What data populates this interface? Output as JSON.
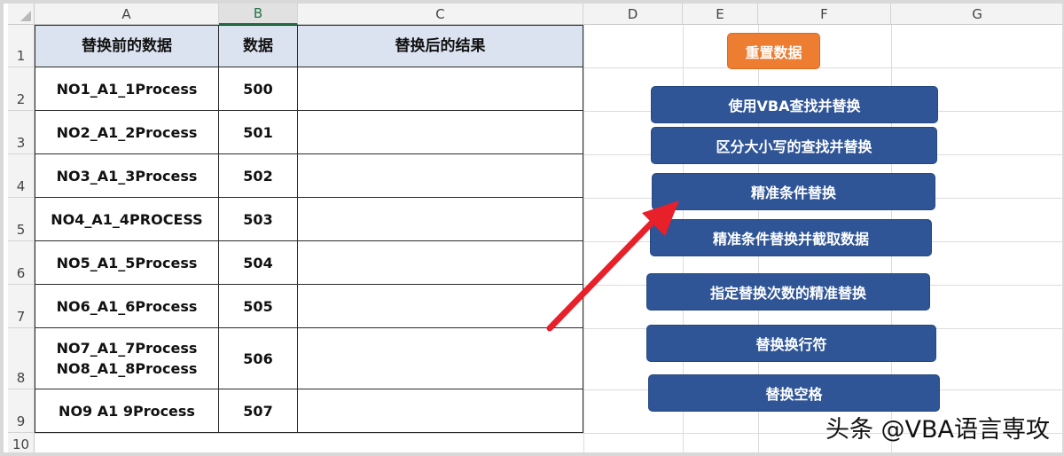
{
  "columns": [
    "A",
    "B",
    "C",
    "D",
    "E",
    "F",
    "G"
  ],
  "rows": [
    "1",
    "2",
    "3",
    "4",
    "5",
    "6",
    "7",
    "8",
    "9",
    "10"
  ],
  "table": {
    "headers": [
      "替换前的数据",
      "数据",
      "替换后的结果"
    ],
    "rows": [
      {
        "text": [
          "NO1_A1_1Process"
        ],
        "value": "500",
        "result": ""
      },
      {
        "text": [
          "NO2_A1_2Process"
        ],
        "value": "501",
        "result": ""
      },
      {
        "text": [
          "NO3_A1_3Process"
        ],
        "value": "502",
        "result": ""
      },
      {
        "text": [
          "NO4_A1_4PROCESS"
        ],
        "value": "503",
        "result": ""
      },
      {
        "text": [
          "NO5_A1_5Process"
        ],
        "value": "504",
        "result": ""
      },
      {
        "text": [
          "NO6_A1_6Process"
        ],
        "value": "505",
        "result": ""
      },
      {
        "text": [
          "NO7_A1_7Process",
          "NO8_A1_8Process"
        ],
        "value": "506",
        "result": ""
      },
      {
        "text": [
          "NO9 A1 9Process"
        ],
        "value": "507",
        "result": ""
      }
    ]
  },
  "buttons": {
    "reset": "重置数据",
    "vba_find_replace": "使用VBA查找并替换",
    "case_sensitive": "区分大小写的查找并替换",
    "exact_replace": "精准条件替换",
    "exact_replace_extract": "精准条件替换并截取数据",
    "count_exact_replace": "指定替换次数的精准替换",
    "replace_newline": "替换换行符",
    "replace_space": "替换空格"
  },
  "watermark": "头条 @VBA语言専攻",
  "colors": {
    "button_blue": "#2f5597",
    "button_orange": "#ed7d31",
    "header_fill": "#dce3f0",
    "arrow": "#e8202a",
    "selected_col": "#217346"
  }
}
